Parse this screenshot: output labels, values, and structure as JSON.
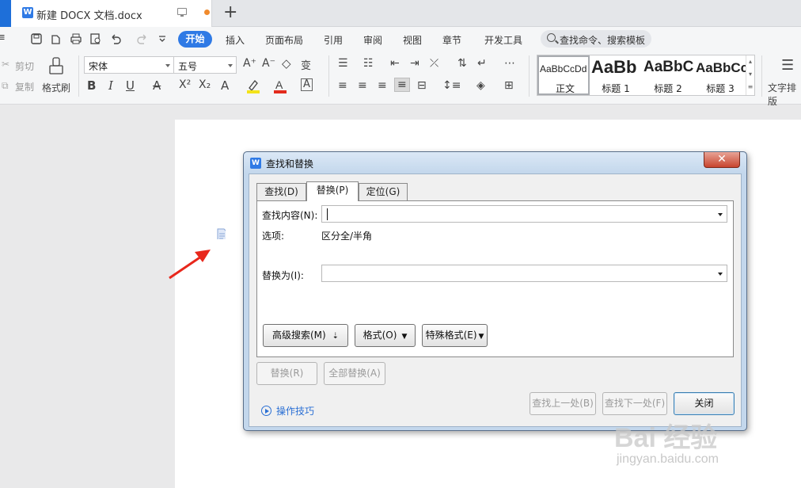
{
  "titlebar": {
    "doc_title": "新建 DOCX 文档.docx",
    "new_tab_glyph": "+"
  },
  "menubar": {
    "quick_icons": [
      "≡",
      "save-icon",
      "paste-icon",
      "print-icon",
      "preview-icon",
      "undo-icon",
      "redo-icon",
      "dropdown-icon"
    ],
    "items": [
      "开始",
      "插入",
      "页面布局",
      "引用",
      "审阅",
      "视图",
      "章节",
      "开发工具"
    ],
    "search_label": "查找命令、搜索模板"
  },
  "ribbon": {
    "cut": "剪切",
    "copy": "复制",
    "format_painter": "格式刷",
    "font_name": "宋体",
    "font_size": "五号",
    "styles": [
      {
        "preview": "AaBbCcDd",
        "name": "正文"
      },
      {
        "preview": "AaBb",
        "name": "标题 1"
      },
      {
        "preview": "AaBbC",
        "name": "标题 2"
      },
      {
        "preview": "AaBbCc",
        "name": "标题 3"
      }
    ],
    "text_layout": "文字排版"
  },
  "dialog": {
    "title": "查找和替换",
    "close_glyph": "✕",
    "tabs": [
      "查找(D)",
      "替换(P)",
      "定位(G)"
    ],
    "active_tab": 1,
    "find_label": "查找内容(N):",
    "find_value": "",
    "options_label": "选项:",
    "options_value": "区分全/半角",
    "replace_label": "替换为(I):",
    "replace_value": "",
    "advanced_search": "高级搜索(M)",
    "format": "格式(O)",
    "special_format": "特殊格式(E)",
    "replace_btn": "替换(R)",
    "replace_all_btn": "全部替换(A)",
    "find_prev": "查找上一处(B)",
    "find_next": "查找下一处(F)",
    "close_btn": "关闭",
    "tips": "操作技巧"
  },
  "watermark": {
    "brand": "Bai 经验",
    "url": "jingyan.baidu.com"
  },
  "colors": {
    "accent": "#2f7ae5",
    "tab_dot": "#f08a2c",
    "annotation_arrow": "#e8271c"
  }
}
